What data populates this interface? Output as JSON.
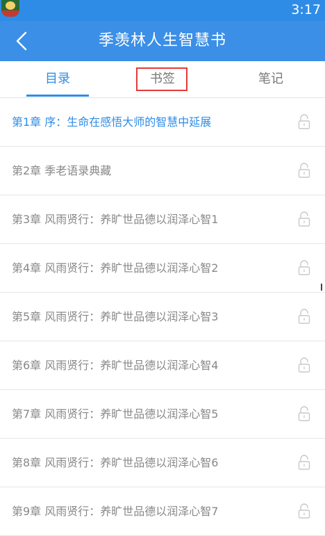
{
  "status_bar": {
    "time": "3:17"
  },
  "header": {
    "title": "季羡林人生智慧书",
    "back_icon": "chevron-left-icon"
  },
  "tabs": [
    {
      "label": "目录",
      "active": true
    },
    {
      "label": "书签",
      "active": false,
      "highlighted": true
    },
    {
      "label": "笔记",
      "active": false
    }
  ],
  "chapters": [
    {
      "label": "第1章 序：生命在感悟大师的智慧中延展",
      "active": true,
      "icon": "lock-icon"
    },
    {
      "label": "第2章 季老语录典藏",
      "active": false,
      "icon": "lock-icon"
    },
    {
      "label": "第3章 风雨贤行：养旷世品德以润泽心智1",
      "active": false,
      "icon": "lock-icon"
    },
    {
      "label": "第4章 风雨贤行：养旷世品德以润泽心智2",
      "active": false,
      "icon": "lock-icon"
    },
    {
      "label": "第5章 风雨贤行：养旷世品德以润泽心智3",
      "active": false,
      "icon": "lock-icon"
    },
    {
      "label": "第6章 风雨贤行：养旷世品德以润泽心智4",
      "active": false,
      "icon": "lock-icon"
    },
    {
      "label": "第7章 风雨贤行：养旷世品德以润泽心智5",
      "active": false,
      "icon": "lock-icon"
    },
    {
      "label": "第8章 风雨贤行：养旷世品德以润泽心智6",
      "active": false,
      "icon": "lock-icon"
    },
    {
      "label": "第9章 风雨贤行：养旷世品德以润泽心智7",
      "active": false,
      "icon": "lock-icon"
    }
  ],
  "colors": {
    "accent": "#2f8ce6",
    "header": "#3b8fe6",
    "highlight_border": "#e23a3a",
    "muted_text": "#888888"
  }
}
